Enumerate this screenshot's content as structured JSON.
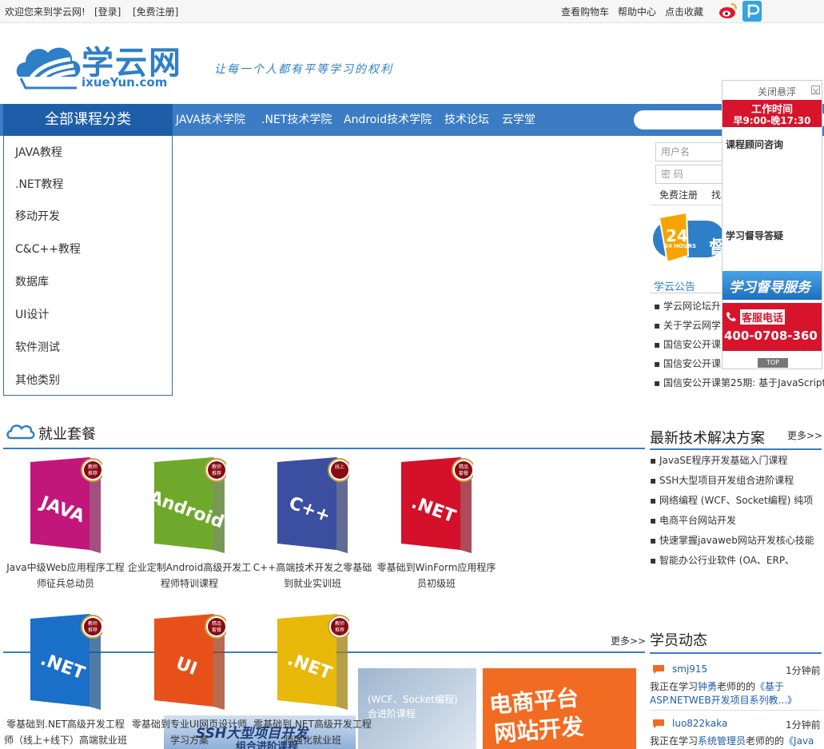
{
  "topbar": {
    "welcome": "欢迎您来到学云网!",
    "login": "[登录]",
    "register": "[免费注册]",
    "cart": "查看购物车",
    "help": "帮助中心",
    "favorite": "点击收藏"
  },
  "logo": {
    "name": "学云网",
    "domain": "ixueYun.com",
    "slogan": "让每一个人都有平等学习的权利"
  },
  "nav": {
    "all_categories": "全部课程分类",
    "links": [
      "JAVA技术学院",
      ".NET技术学院",
      "Android技术学院",
      "技术论坛",
      "云学堂"
    ]
  },
  "categories": [
    "JAVA教程",
    ".NET教程",
    "移动开发",
    "C&C++教程",
    "数据库",
    "UI设计",
    "软件测试",
    "其他类别"
  ],
  "login": {
    "username_placeholder": "用户名",
    "password_placeholder": "密  码",
    "register": "免费注册",
    "find": "找"
  },
  "badge": {
    "text": "24 HOURS",
    "side": "督"
  },
  "notices": {
    "title": "学云公告",
    "items": [
      "学云网论坛升",
      "关于学云网学",
      "国信安公开课",
      "国信安公开课",
      "国信安公开课第25期: 基于JavaScript"
    ]
  },
  "jobs": {
    "title": "就业套餐",
    "products": [
      {
        "name": "Java中级Web应用程序工程师征兵总动员",
        "line1": "Java中级Web应用程序工程",
        "line2": "师征兵总动员",
        "label": "JAVA",
        "badge": "教师推荐",
        "color": "#c2177a"
      },
      {
        "name": "企业定制Android高级开发工程师特训课程",
        "line1": "企业定制Android高级开发工",
        "line2": "程师特训课程",
        "label": "Android",
        "badge": "教师推荐",
        "color": "#6fa82a"
      },
      {
        "name": "C++高端技术开发之零基础到就业实训班",
        "line1": "C++高端技术开发之零基础",
        "line2": "到就业实训班",
        "label": "C++",
        "badge": "线上",
        "color": "#3c4ea0"
      },
      {
        "name": "零基础到WinForm应用程序员初级班",
        "line1": "零基础到WinForm应用程序",
        "line2": "员初级班",
        "label": ".NET",
        "badge": "精品套餐",
        "color": "#d4102b"
      }
    ],
    "products2": [
      {
        "line1": "零基础到.NET高级开发工程",
        "line2": "师（线上+线下）高端就业班",
        "label": ".NET",
        "badge": "教师推荐",
        "color": "#1a6fc8"
      },
      {
        "line1": "零基础到专业UI网页设计师",
        "line2": "学习方案",
        "label": "UI",
        "badge": "精品套餐",
        "color": "#e8501a"
      },
      {
        "line1": "零基础到.NET高级开发工程",
        "line2": "师强化就业班",
        "label": ".NET",
        "badge": "教师推荐",
        "color": "#e8b80a"
      }
    ]
  },
  "solutions": {
    "title": "最新技术解决方案",
    "more": "更多>>",
    "items": [
      "JavaSE程序开发基础入门课程",
      "SSH大型项目开发组合进阶课程",
      "网络编程 (WCF、Socket编程) 纯项",
      "电商平台网站开发",
      "快速掌握javaweb网站开发核心技能",
      "智能办公行业软件 (OA、ERP、"
    ]
  },
  "banners": {
    "more": "更多>>",
    "wcf": "(WCF、Socket编程)",
    "wcf_sub": "合进阶课程",
    "ssh1": "SSH大型项目开发",
    "ssh2": "组合进阶课程",
    "ecom1": "电商平台",
    "ecom2": "网站开发"
  },
  "activity": {
    "title": "学员动态",
    "items": [
      {
        "user": "smj915",
        "time": "1分钟前",
        "pre": "我正在学习",
        "teacher": "钟勇",
        "mid": "老师的的",
        "course": "《基于",
        "course2": "ASP.NETWEB开发项目系列教...》"
      },
      {
        "user": "luo822kaka",
        "time": "1分钟前",
        "pre": "我正在学习",
        "teacher": "系统管理员",
        "mid": "老师的的",
        "course": "《Java",
        "course2": ""
      }
    ]
  },
  "float_panel": {
    "close": "关闭悬浮",
    "hours_title": "工作时间",
    "hours": "早9:00-晚17:30",
    "consult": "课程顾问咨询",
    "supervise": "学习督导答疑",
    "service": "学习督导服务",
    "phone_label": "客服电话",
    "phone": "400-0708-360",
    "top": "TOP"
  },
  "colors": {
    "nav": "#3b7cc4",
    "nav_dark": "#1e5ea8",
    "red": "#d40000"
  }
}
